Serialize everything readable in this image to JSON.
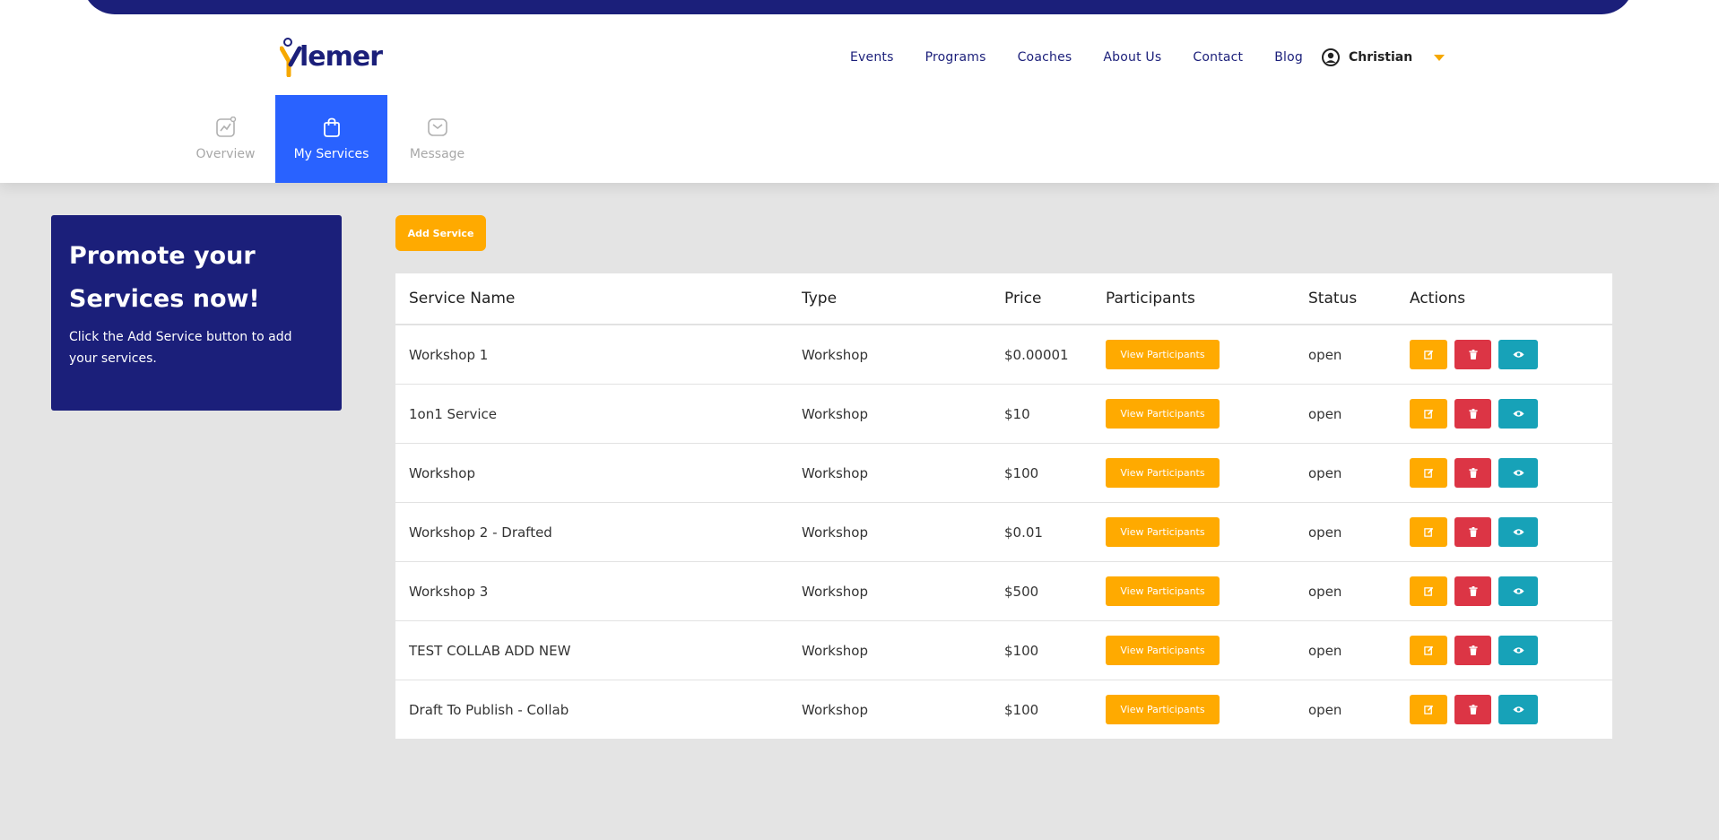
{
  "brand": {
    "logo_text": "lemer",
    "colors": {
      "navy": "#1b1f7a",
      "accent": "#ffaa00",
      "active_tab": "#2962ff",
      "danger": "#dc3545",
      "info": "#17a2b8"
    }
  },
  "nav": {
    "links": [
      "Events",
      "Programs",
      "Coaches",
      "About Us",
      "Contact",
      "Blog"
    ],
    "user_name": "Christian"
  },
  "tabs": [
    {
      "label": "Overview",
      "icon": "chart-icon"
    },
    {
      "label": "My Services",
      "icon": "bag-icon",
      "active": true
    },
    {
      "label": "Message",
      "icon": "envelope-icon"
    }
  ],
  "promo": {
    "title": "Promote your Services now!",
    "text": "Click the Add Service button to add your services."
  },
  "add_service_label": "Add Service",
  "table": {
    "headers": [
      "Service Name",
      "Type",
      "Price",
      "Participants",
      "Status",
      "Actions"
    ],
    "view_participants_label": "View Participants",
    "rows": [
      {
        "name": "Workshop 1",
        "type": "Workshop",
        "price": "$0.00001",
        "status": "open"
      },
      {
        "name": "1on1 Service",
        "type": "Workshop",
        "price": "$10",
        "status": "open"
      },
      {
        "name": "Workshop",
        "type": "Workshop",
        "price": "$100",
        "status": "open"
      },
      {
        "name": "Workshop 2 - Drafted",
        "type": "Workshop",
        "price": "$0.01",
        "status": "open"
      },
      {
        "name": "Workshop 3",
        "type": "Workshop",
        "price": "$500",
        "status": "open"
      },
      {
        "name": "TEST COLLAB ADD NEW",
        "type": "Workshop",
        "price": "$100",
        "status": "open"
      },
      {
        "name": "Draft To Publish - Collab",
        "type": "Workshop",
        "price": "$100",
        "status": "open"
      }
    ]
  }
}
